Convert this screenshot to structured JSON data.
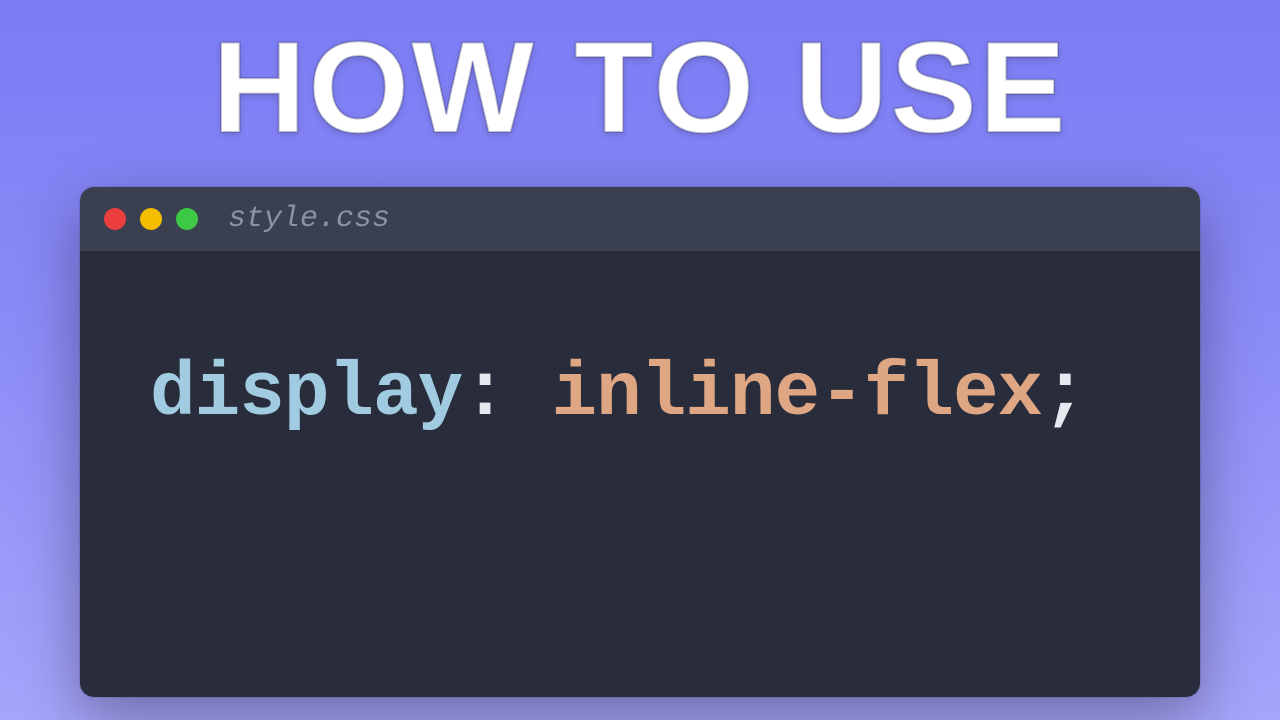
{
  "headline": "HOW TO USE",
  "window": {
    "filename": "style.css",
    "traffic_colors": {
      "close": "#ed3e3e",
      "minimize": "#f5bd00",
      "zoom": "#3dc943"
    }
  },
  "code": {
    "property": "display",
    "colon": ":",
    "space": " ",
    "value": "inline-flex",
    "semicolon": ";"
  }
}
